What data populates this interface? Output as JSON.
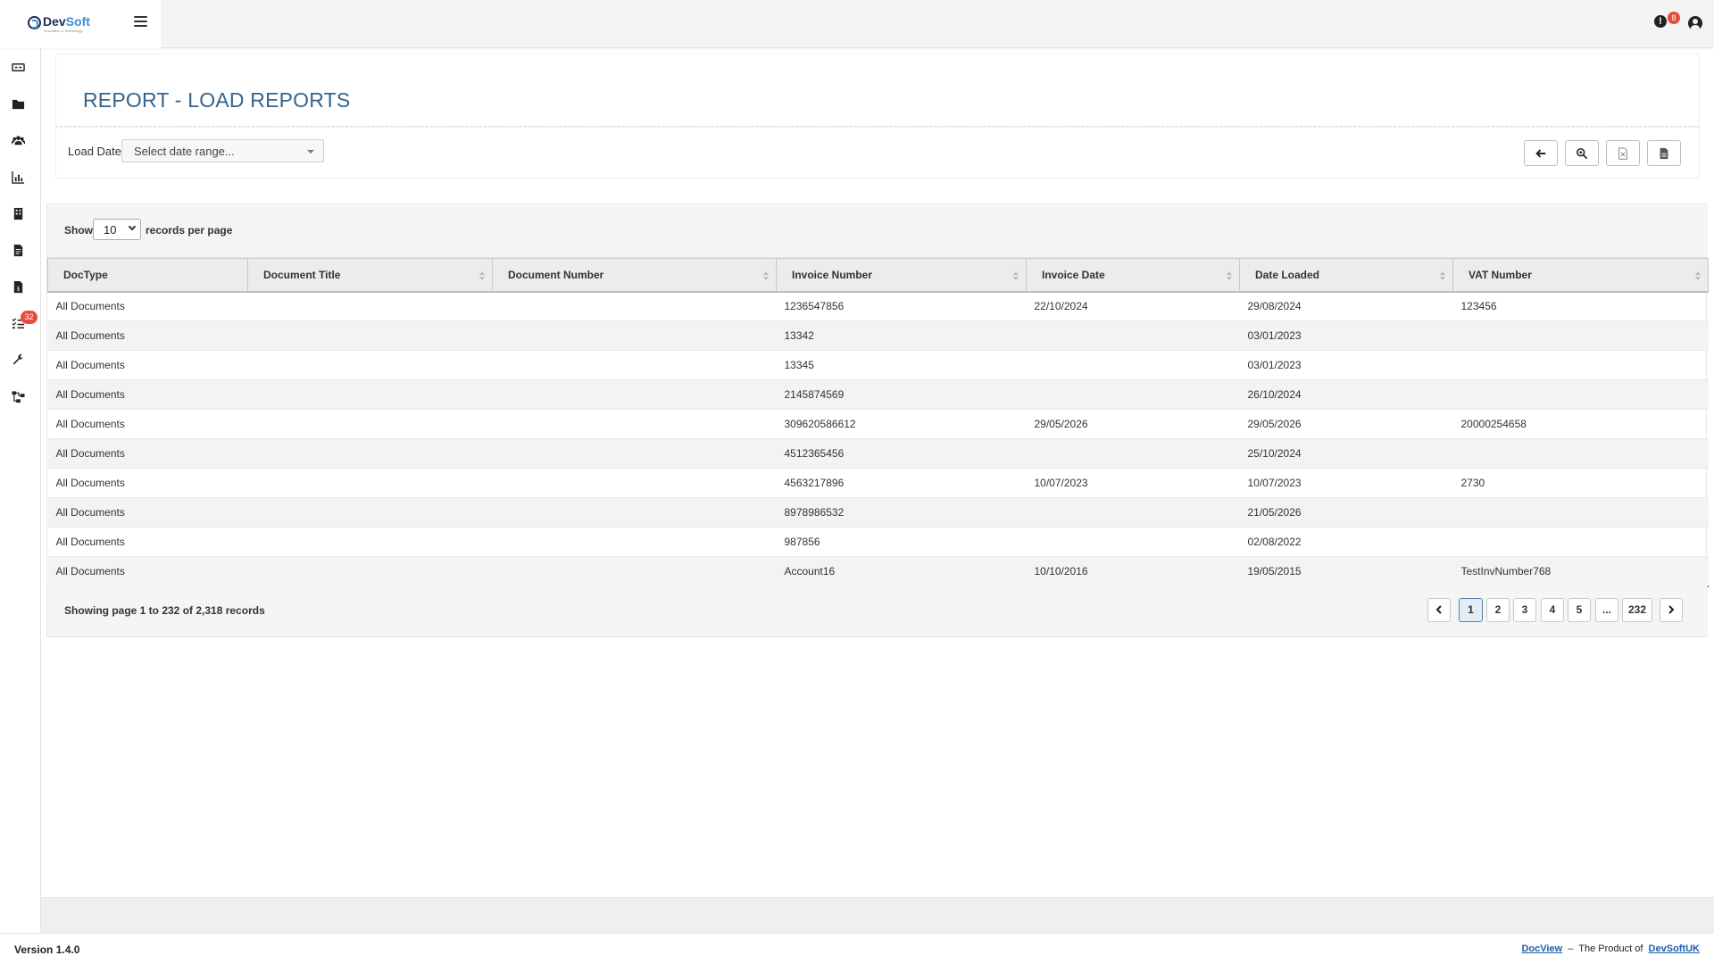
{
  "topbar": {
    "logo": {
      "brand_dev": "Dev",
      "brand_soft": "Soft",
      "tagline": "Innovation & Technology"
    },
    "notifications_count": "8"
  },
  "sidebar": {
    "items": [
      {
        "name": "dashboard-icon"
      },
      {
        "name": "folder-icon"
      },
      {
        "name": "users-icon"
      },
      {
        "name": "bar-chart-icon"
      },
      {
        "name": "building-icon"
      },
      {
        "name": "document-icon"
      },
      {
        "name": "invoice-icon"
      },
      {
        "name": "task-list-icon",
        "badge": "32"
      },
      {
        "name": "wrench-icon"
      },
      {
        "name": "workflow-icon"
      }
    ]
  },
  "header": {
    "title": "REPORT - LOAD REPORTS"
  },
  "filter": {
    "label": "Load Date",
    "date_placeholder": "Select date range...",
    "buttons": [
      {
        "name": "back-arrow-icon"
      },
      {
        "name": "search-icon"
      },
      {
        "name": "excel-export-icon"
      },
      {
        "name": "csv-export-icon"
      }
    ]
  },
  "table": {
    "show_label": "Show",
    "page_size": "10",
    "per_page_label": "records per page",
    "columns": [
      "DocType",
      "Document Title",
      "Document Number",
      "Invoice Number",
      "Invoice Date",
      "Date Loaded",
      "VAT Number"
    ],
    "rows": [
      [
        "All Documents",
        "",
        "",
        "1236547856",
        "22/10/2024",
        "29/08/2024",
        "123456"
      ],
      [
        "All Documents",
        "",
        "",
        "13342",
        "",
        "03/01/2023",
        ""
      ],
      [
        "All Documents",
        "",
        "",
        "13345",
        "",
        "03/01/2023",
        ""
      ],
      [
        "All Documents",
        "",
        "",
        "2145874569",
        "",
        "26/10/2024",
        ""
      ],
      [
        "All Documents",
        "",
        "",
        "309620586612",
        "29/05/2026",
        "29/05/2026",
        "20000254658"
      ],
      [
        "All Documents",
        "",
        "",
        "4512365456",
        "",
        "25/10/2024",
        ""
      ],
      [
        "All Documents",
        "",
        "",
        "4563217896",
        "10/07/2023",
        "10/07/2023",
        "2730"
      ],
      [
        "All Documents",
        "",
        "",
        "8978986532",
        "",
        "21/05/2026",
        ""
      ],
      [
        "All Documents",
        "",
        "",
        "987856",
        "",
        "02/08/2022",
        ""
      ],
      [
        "All Documents",
        "",
        "",
        "Account16",
        "10/10/2016",
        "19/05/2015",
        "TestInvNumber768"
      ]
    ],
    "showing_text": "Showing page 1 to 232 of 2,318 records",
    "pagination": [
      "1",
      "2",
      "3",
      "4",
      "5",
      "...",
      "232"
    ],
    "active_page": "1"
  },
  "footer": {
    "version": "Version 1.4.0",
    "product_link": "DocView",
    "separator": "–",
    "product_of": "The Product of",
    "company_link": "DevSoftUK"
  },
  "colors": {
    "title": "#36648b",
    "badge": "#e74c3c",
    "link": "#1f5fa8"
  }
}
